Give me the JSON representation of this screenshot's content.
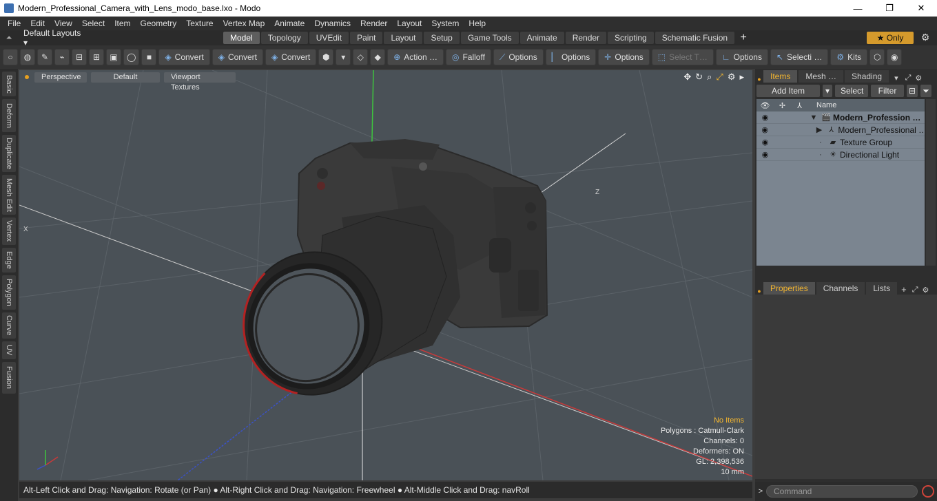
{
  "window": {
    "title": "Modern_Professional_Camera_with_Lens_modo_base.lxo - Modo",
    "minimize": "—",
    "maximize": "❐",
    "close": "✕"
  },
  "menu": [
    "File",
    "Edit",
    "View",
    "Select",
    "Item",
    "Geometry",
    "Texture",
    "Vertex Map",
    "Animate",
    "Dynamics",
    "Render",
    "Layout",
    "System",
    "Help"
  ],
  "layouts": {
    "selector": "Default Layouts ▾",
    "tabs": [
      "Model",
      "Topology",
      "UVEdit",
      "Paint",
      "Layout",
      "Setup",
      "Game Tools",
      "Animate",
      "Render",
      "Scripting",
      "Schematic Fusion"
    ],
    "active_tab": "Model",
    "add": "+",
    "only": "★  Only",
    "settings": "⚙"
  },
  "toolbar": {
    "convert1": "Convert",
    "convert2": "Convert",
    "convert3": "Convert",
    "action": "Action  …",
    "falloff": "Falloff",
    "options1": "Options",
    "options2": "Options",
    "options3": "Options",
    "select_t": "Select T…",
    "options4": "Options",
    "selecti": "Selecti …",
    "kits": "Kits"
  },
  "left_tabs": [
    "Basic",
    "Deform",
    "Duplicate",
    "Mesh Edit",
    "Vertex",
    "Edge",
    "Polygon",
    "Curve",
    "UV",
    "Fusion"
  ],
  "viewport": {
    "view": "Perspective",
    "shading": "Default",
    "textures": "Viewport Textures",
    "axis_x": "X",
    "axis_z": "Z",
    "info": {
      "items": "No Items",
      "polygons": "Polygons : Catmull-Clark",
      "channels": "Channels: 0",
      "deformers": "Deformers: ON",
      "gl": "GL: 2,398,536",
      "scale": "10 mm"
    }
  },
  "status": "Alt-Left Click and Drag: Navigation: Rotate (or Pan) ● Alt-Right Click and Drag: Navigation: Freewheel ● Alt-Middle Click and Drag: navRoll",
  "items_panel": {
    "tabs": [
      "Items",
      "Mesh …",
      "Shading"
    ],
    "add_item": "Add Item",
    "select": "Select",
    "filter": "Filter",
    "name_header": "Name",
    "rows": [
      {
        "label": "Modern_Profession …",
        "bold": true
      },
      {
        "label": "Modern_Professional …",
        "bold": false
      },
      {
        "label": "Texture Group",
        "bold": false
      },
      {
        "label": "Directional Light",
        "bold": false
      }
    ]
  },
  "props_panel": {
    "tabs": [
      "Properties",
      "Channels",
      "Lists"
    ],
    "add": "+"
  },
  "command": {
    "placeholder": "Command"
  }
}
